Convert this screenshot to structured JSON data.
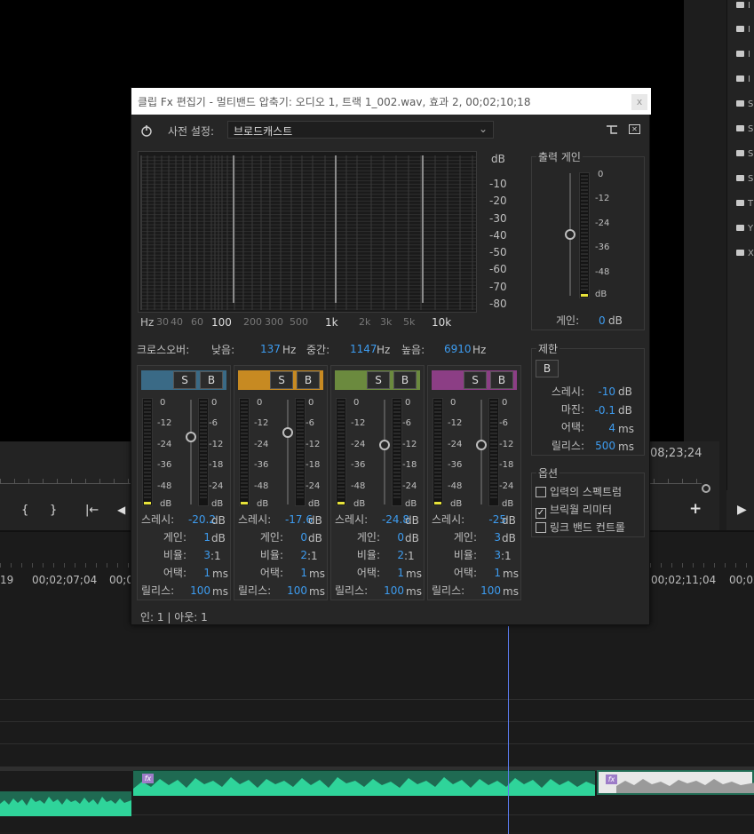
{
  "background": {
    "right_panel_labels": [
      "I",
      "I",
      "I",
      "I",
      "S",
      "S",
      "S",
      "S",
      "T",
      "Y",
      "X"
    ],
    "monitor_timecode": "08;23;24",
    "timeline_times": [
      "19",
      "00;02;07;04",
      "00;0",
      "00;02;11;04",
      "00;02"
    ],
    "transport_icons": [
      "mark-in-icon",
      "mark-out-icon",
      "go-to-in-icon",
      "step-back-icon",
      "add-icon",
      "play-icon"
    ]
  },
  "dialog": {
    "title": "클립 Fx 편집기 - 멀티밴드 압축기: 오디오 1, 트랙 1_002.wav, 효과 2, 00;02;10;18",
    "close_label": "x",
    "preset_label": "사전 설정:",
    "preset_value": "브로드캐스트",
    "spectrum": {
      "db_labels": [
        "dB",
        "-10",
        "-20",
        "-30",
        "-40",
        "-50",
        "-60",
        "-70",
        "-80"
      ],
      "hz_labels": [
        "Hz",
        "30",
        "40",
        "60",
        "100",
        "200",
        "300",
        "500",
        "1k",
        "2k",
        "3k",
        "5k",
        "10k"
      ]
    },
    "crossover": {
      "label": "크로스오버:",
      "low_label": "낮음:",
      "low_value": "137",
      "low_unit": "Hz",
      "mid_label": "중간:",
      "mid_value": "1147",
      "mid_unit": "Hz",
      "high_label": "높음:",
      "high_value": "6910",
      "high_unit": "Hz"
    },
    "band_labels": {
      "solo": "S",
      "bypass": "B",
      "threshold": "스레시:",
      "gain": "게인:",
      "ratio": "비율:",
      "attack": "어택:",
      "release": "릴리스:",
      "meter_left_ticks": [
        "0",
        "-12",
        "-24",
        "-36",
        "-48",
        "dB"
      ],
      "meter_right_ticks": [
        "0",
        "-6",
        "-12",
        "-18",
        "-24",
        "dB"
      ],
      "db_unit": "dB",
      "ratio_unit": ":1",
      "ms_unit": "ms"
    },
    "bands": [
      {
        "color": "#3a6a86",
        "threshold": "-20.2",
        "gain": "1",
        "ratio": "3",
        "attack": "1",
        "release": "100"
      },
      {
        "color": "#c78a22",
        "threshold": "-17.6",
        "gain": "0",
        "ratio": "2",
        "attack": "1",
        "release": "100"
      },
      {
        "color": "#6b8a3e",
        "threshold": "-24.8",
        "gain": "0",
        "ratio": "2",
        "attack": "1",
        "release": "100"
      },
      {
        "color": "#8c3e85",
        "threshold": "-25",
        "gain": "3",
        "ratio": "3",
        "attack": "1",
        "release": "100"
      }
    ],
    "output": {
      "title": "출력 게인",
      "ticks": [
        "0",
        "-12",
        "-24",
        "-36",
        "-48",
        "dB"
      ],
      "gain_label": "게인:",
      "gain_value": "0",
      "gain_unit": "dB"
    },
    "limiter": {
      "title": "제한",
      "bypass": "B",
      "threshold_label": "스레시:",
      "threshold_value": "-10",
      "threshold_unit": "dB",
      "margin_label": "마진:",
      "margin_value": "-0.1",
      "margin_unit": "dB",
      "attack_label": "어택:",
      "attack_value": "4",
      "attack_unit": "ms",
      "release_label": "릴리스:",
      "release_value": "500",
      "release_unit": "ms"
    },
    "options": {
      "title": "옵션",
      "items": [
        {
          "label": "입력의 스펙트럼",
          "checked": false
        },
        {
          "label": "브릭월 리미터",
          "checked": true
        },
        {
          "label": "링크 밴드 컨트롤",
          "checked": false
        }
      ]
    },
    "io_label": "인: 1 | 아웃: 1"
  }
}
